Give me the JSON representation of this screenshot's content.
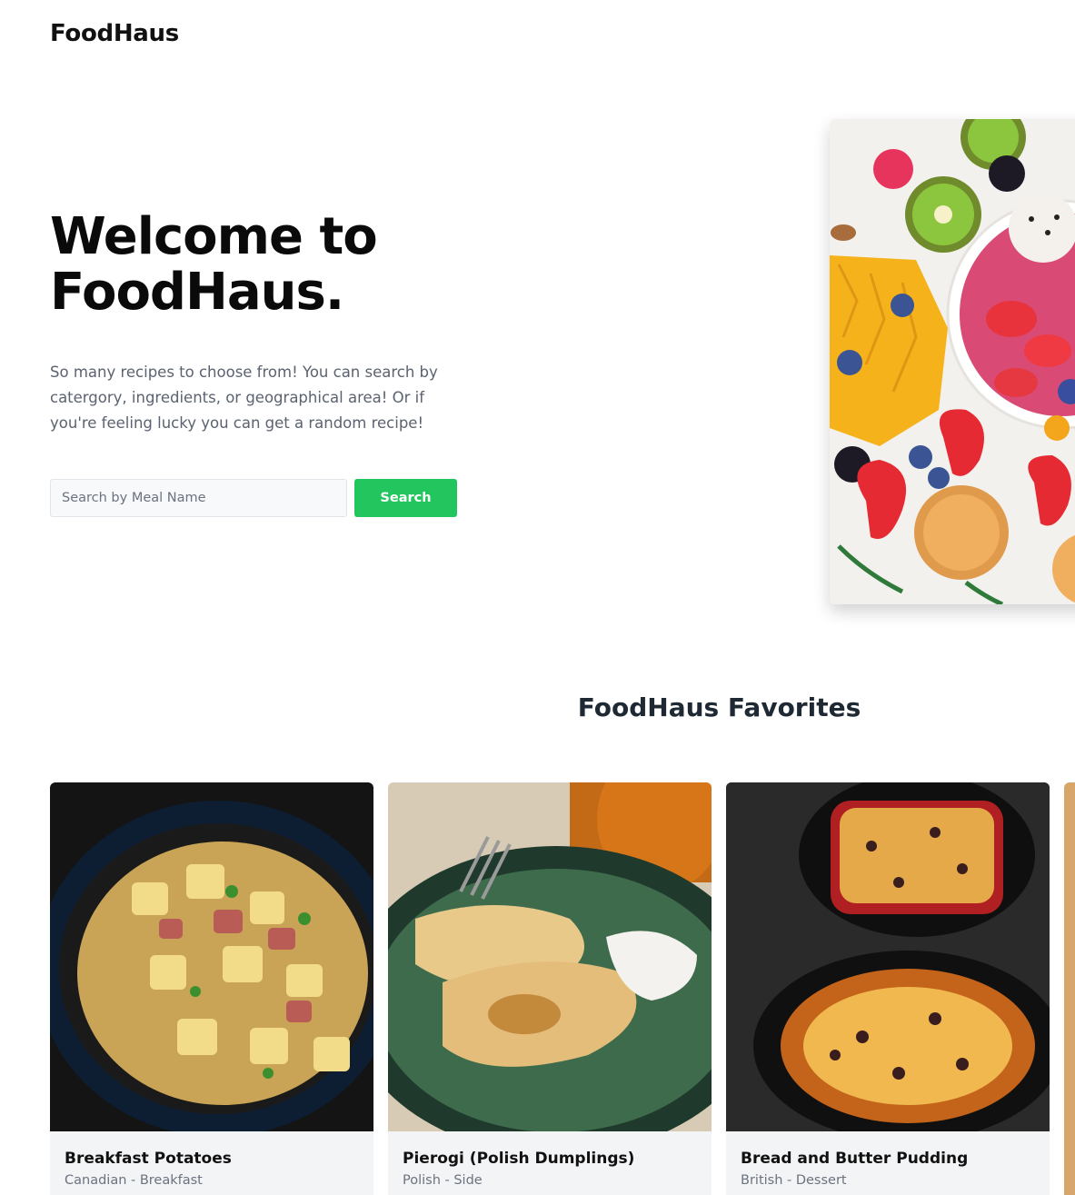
{
  "header": {
    "brand": "FoodHaus"
  },
  "hero": {
    "title": "Welcome to FoodHaus.",
    "description": "So many recipes to choose from! You can search by catergory, ingredients, or geographical area! Or if you're feeling lucky you can get a random recipe!",
    "search": {
      "placeholder": "Search by Meal Name",
      "value": "",
      "button_label": "Search"
    },
    "image_alt": "fruit bowl"
  },
  "favorites": {
    "title": "FoodHaus Favorites",
    "cards": [
      {
        "name": "Breakfast Potatoes",
        "subtitle": "Canadian - Breakfast"
      },
      {
        "name": "Pierogi (Polish Dumplings)",
        "subtitle": "Polish - Side"
      },
      {
        "name": "Bread and Butter Pudding",
        "subtitle": "British - Dessert"
      }
    ]
  },
  "colors": {
    "accent": "#22c55e",
    "text_muted": "#6b7280",
    "card_bg": "#f3f4f6"
  }
}
